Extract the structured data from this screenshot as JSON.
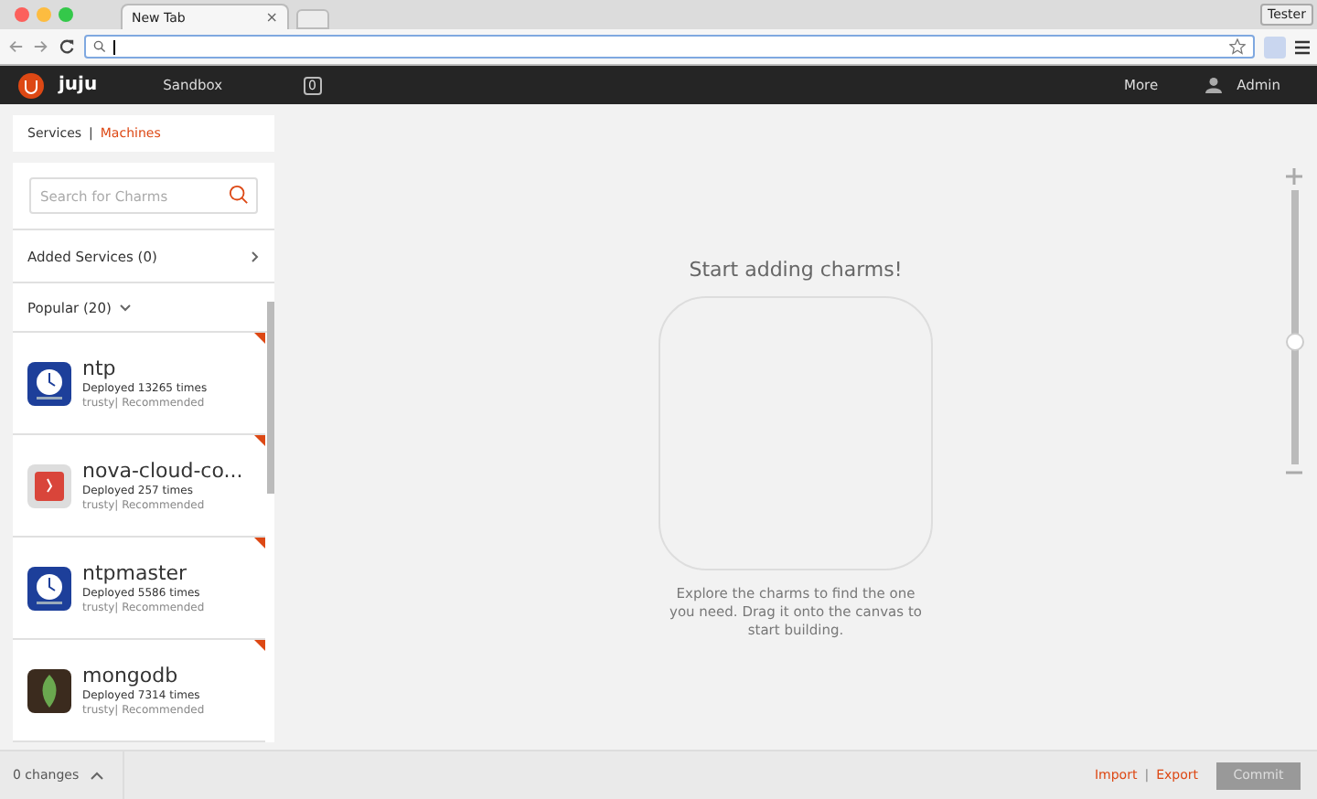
{
  "browser": {
    "tab_title": "New Tab",
    "tab_close": "×",
    "profile": "Tester"
  },
  "header": {
    "logo": "juju",
    "env": "Sandbox",
    "count": "0",
    "more": "More",
    "user": "Admin"
  },
  "sidebar": {
    "tabs": [
      {
        "label": "Services",
        "selected": true
      },
      {
        "label": "Machines",
        "selected": false
      }
    ],
    "separator": "|",
    "search": {
      "placeholder": "Search for Charms"
    },
    "added": "Added Services (0)",
    "popular": "Popular (20)",
    "charms": [
      {
        "name": "ntp",
        "deployed": "Deployed 13265 times",
        "meta": "trusty| Recommended",
        "kind": "clock"
      },
      {
        "name": "nova-cloud-co...",
        "deployed": "Deployed 257 times",
        "meta": "trusty| Recommended",
        "kind": "box"
      },
      {
        "name": "ntpmaster",
        "deployed": "Deployed 5586 times",
        "meta": "trusty| Recommended",
        "kind": "clock"
      },
      {
        "name": "mongodb",
        "deployed": "Deployed 7314 times",
        "meta": "trusty| Recommended",
        "kind": "leaf"
      }
    ]
  },
  "canvas": {
    "title": "Start adding charms!",
    "hint": "Explore the charms to find the one you need. Drag it onto the canvas to start building.",
    "zoom": {
      "level": 0.45
    }
  },
  "footer": {
    "changes": "0 changes",
    "import": "Import",
    "sep": "|",
    "export": "Export",
    "commit": "Commit"
  }
}
